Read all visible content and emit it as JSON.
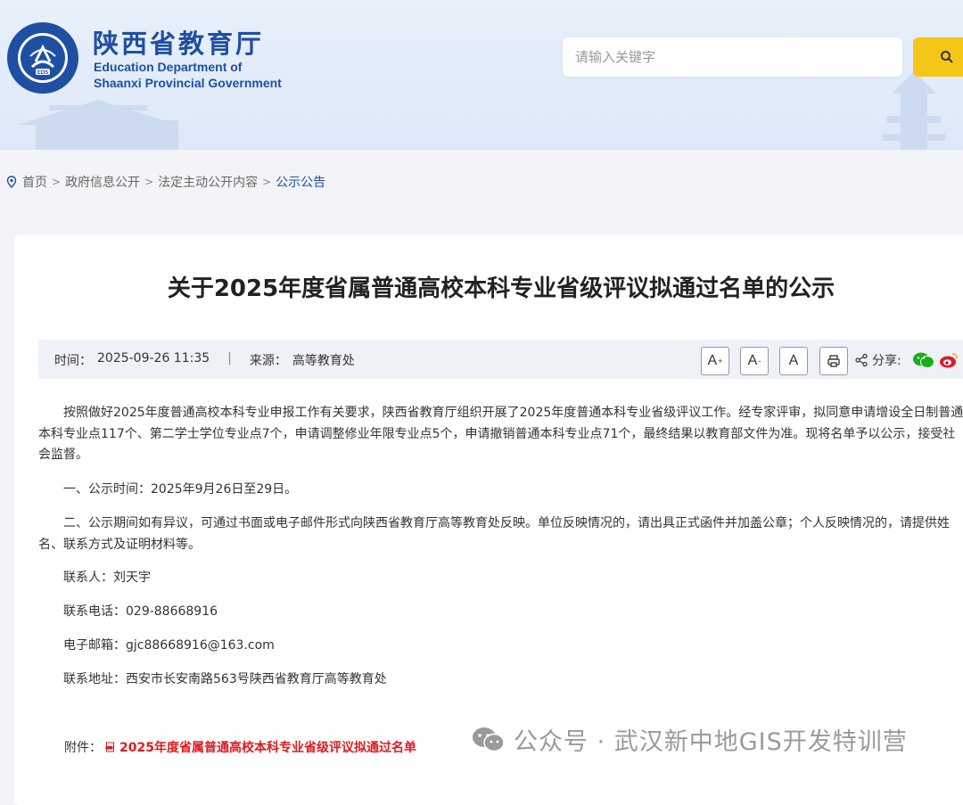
{
  "header": {
    "site_name_cn": "陕西省教育厅",
    "site_name_en_line1": "Education Department of",
    "site_name_en_line2": "Shaanxi Provincial Government",
    "emblem_text": "EDS",
    "emblem_ring_text": "EDUCATION DEPARTMENT OF SHAANXI"
  },
  "search": {
    "placeholder": "请输入关键字"
  },
  "breadcrumb": {
    "items": [
      "首页",
      "政府信息公开",
      "法定主动公开内容",
      "公示公告"
    ],
    "separator": ">"
  },
  "article": {
    "title": "关于2025年度省属普通高校本科专业省级评议拟通过名单的公示",
    "meta": {
      "time_label": "时间：",
      "time_value": "2025-09-26 11:35",
      "divider": "|",
      "source_label": "来源：",
      "source_value": "高等教育处"
    },
    "toolbar": {
      "font_large": "A",
      "font_small": "A",
      "font_normal": "A",
      "share_label": "分享:"
    },
    "paragraphs": [
      "按照做好2025年度普通高校本科专业申报工作有关要求，陕西省教育厅组织开展了2025年度普通本科专业省级评议工作。经专家评审，拟同意申请增设全日制普通本科专业点117个、第二学士学位专业点7个，申请调整修业年限专业点5个，申请撤销普通本科专业点71个，最终结果以教育部文件为准。现将名单予以公示，接受社会监督。",
      "一、公示时间：2025年9月26日至29日。",
      "二、公示期间如有异议，可通过书面或电子邮件形式向陕西省教育厅高等教育处反映。单位反映情况的，请出具正式函件并加盖公章；个人反映情况的，请提供姓名、联系方式及证明材料等。",
      "联系人：刘天宇",
      "联系电话：029-88668916",
      "电子邮箱：gjc88668916@163.com",
      "联系地址：西安市长安南路563号陕西省教育厅高等教育处"
    ],
    "attachment_label": "附件：",
    "attachment_link": "2025年度省属普通高校本科专业省级评议拟通过名单"
  },
  "watermark": {
    "text": "公众号 · 武汉新中地GIS开发特训营"
  },
  "colors": {
    "brand": "#1e4fa3",
    "search_button": "#f5c518",
    "attachment": "#e0191e"
  }
}
